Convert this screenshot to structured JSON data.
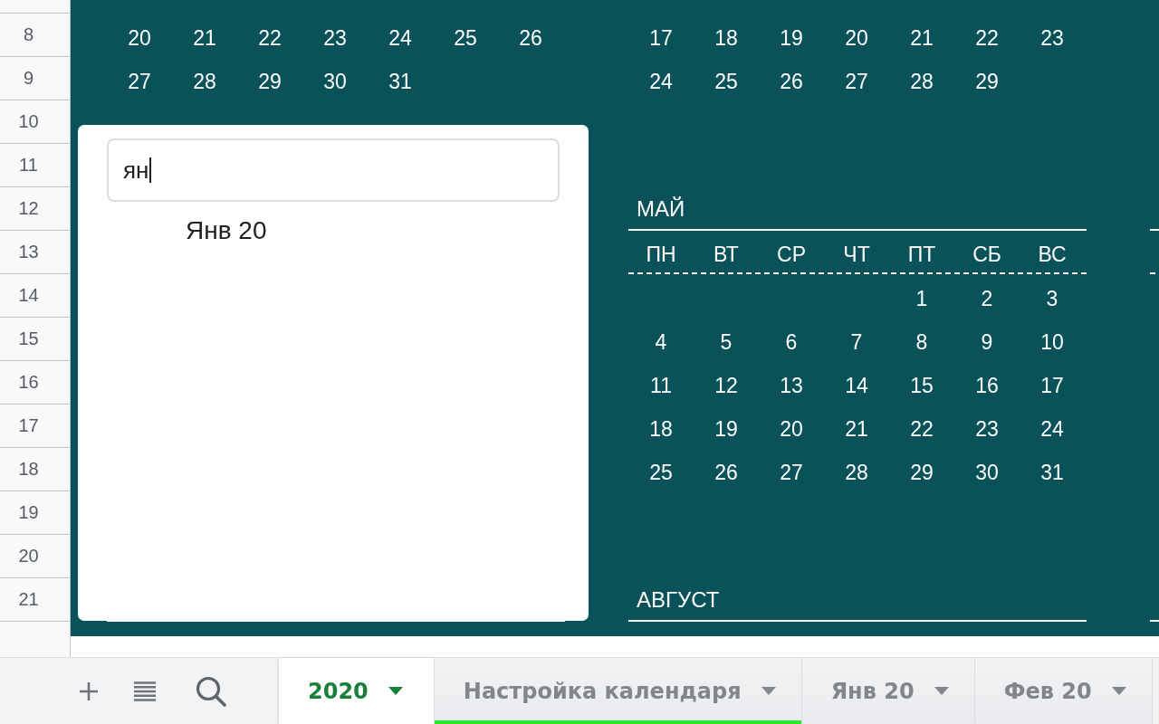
{
  "sheet": {
    "row_numbers": [
      "8",
      "9",
      "10",
      "11",
      "12",
      "13",
      "14",
      "15",
      "16",
      "17",
      "18",
      "19",
      "20",
      "21"
    ],
    "calendars": [
      {
        "weeks": [
          [
            "20",
            "21",
            "22",
            "23",
            "24",
            "25",
            "26"
          ],
          [
            "27",
            "28",
            "29",
            "30",
            "31"
          ]
        ]
      },
      {
        "weeks": [
          [
            "17",
            "18",
            "19",
            "20",
            "21",
            "22",
            "23"
          ],
          [
            "24",
            "25",
            "26",
            "27",
            "28",
            "29"
          ]
        ]
      },
      {
        "title": "МАЙ",
        "weekdays": [
          "ПН",
          "ВТ",
          "СР",
          "ЧТ",
          "ПТ",
          "СБ",
          "ВС"
        ],
        "weeks": [
          [
            "1",
            "2",
            "3"
          ],
          [
            "4",
            "5",
            "6",
            "7",
            "8",
            "9",
            "10"
          ],
          [
            "11",
            "12",
            "13",
            "14",
            "15",
            "16",
            "17"
          ],
          [
            "18",
            "19",
            "20",
            "21",
            "22",
            "23",
            "24"
          ],
          [
            "25",
            "26",
            "27",
            "28",
            "29",
            "30",
            "31"
          ]
        ]
      },
      {
        "title": "АВГУСТ"
      }
    ]
  },
  "popup": {
    "search": {
      "value": "ян",
      "focused": true
    },
    "suggestions": [
      {
        "label": "Янв 20",
        "selected": false
      }
    ]
  },
  "sheet_tabs": [
    {
      "label": "2020",
      "selected": true
    },
    {
      "label": "Настройка календаря",
      "selected": false,
      "color": "#2ee62e"
    },
    {
      "label": "Янв 20",
      "selected": false
    },
    {
      "label": "Фев 20",
      "selected": false
    }
  ]
}
